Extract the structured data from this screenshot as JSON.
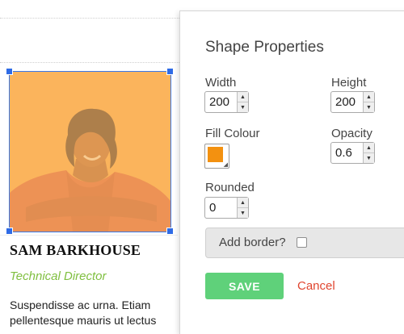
{
  "card": {
    "name": "SAM BARKHOUSE",
    "role": "Technical Director",
    "bio": "Suspendisse ac urna. Etiam pellentesque mauris ut lectus"
  },
  "panel": {
    "title": "Shape Properties",
    "width": {
      "label": "Width",
      "value": "200"
    },
    "height": {
      "label": "Height",
      "value": "200"
    },
    "fill": {
      "label": "Fill Colour",
      "color": "#f39110"
    },
    "opacity": {
      "label": "Opacity",
      "value": "0.6"
    },
    "rounded": {
      "label": "Rounded",
      "value": "0"
    },
    "border": {
      "label": "Add border?",
      "checked": false
    },
    "save_label": "SAVE",
    "cancel_label": "Cancel"
  },
  "colors": {
    "shape_fill": "#f6a13a",
    "selection": "#3b78e7",
    "save_button": "#5fd17a",
    "cancel_text": "#e0452f",
    "role_text": "#7fbf3f"
  }
}
